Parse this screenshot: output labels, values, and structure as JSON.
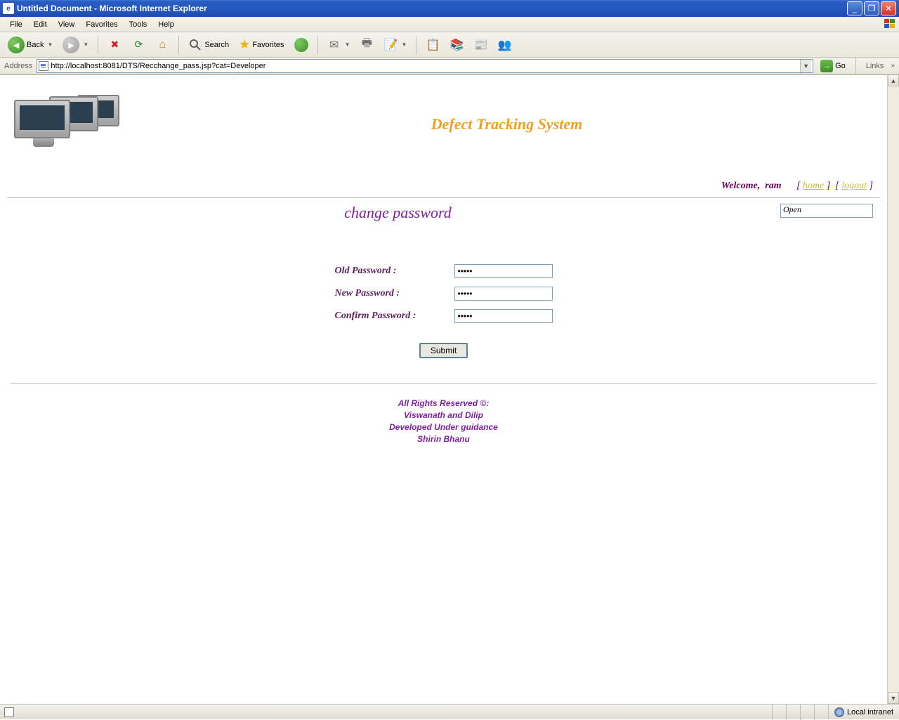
{
  "window": {
    "title": "Untitled Document - Microsoft Internet Explorer"
  },
  "menu": {
    "file": "File",
    "edit": "Edit",
    "view": "View",
    "favorites": "Favorites",
    "tools": "Tools",
    "help": "Help"
  },
  "toolbar": {
    "back": "Back",
    "search": "Search",
    "favorites": "Favorites"
  },
  "addressbar": {
    "label": "Address",
    "url": "http://localhost:8081/DTS/Recchange_pass.jsp?cat=Developer",
    "go": "Go",
    "links": "Links"
  },
  "page": {
    "app_title": "Defect Tracking System",
    "welcome_label": "Welcome,",
    "username": "ram",
    "home_link": "home",
    "logout_link": "logout",
    "open_select": "Open",
    "form_title": "change password",
    "labels": {
      "old": "Old Password :",
      "new": "New Password :",
      "confirm": "Confirm Password :"
    },
    "values": {
      "old": "•••••",
      "new": "•••••",
      "confirm": "•••••"
    },
    "submit": "Submit",
    "footer": {
      "l1": "All Rights Reserved ©:",
      "l2": "Viswanath and Dilip",
      "l3": "Developed Under guidance",
      "l4": "Shirin Bhanu"
    }
  },
  "statusbar": {
    "zone": "Local intranet"
  }
}
